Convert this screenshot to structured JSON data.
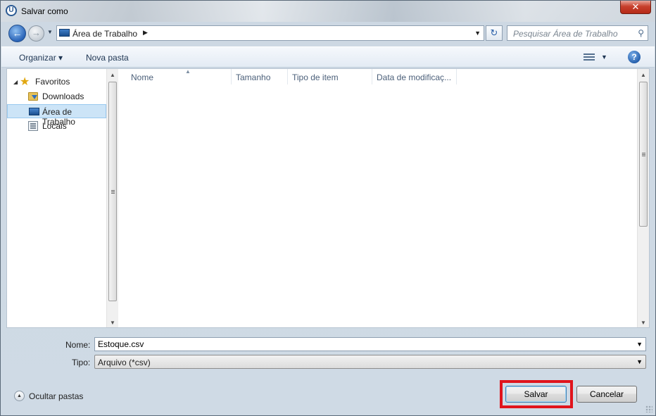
{
  "window": {
    "title": "Salvar como",
    "close_symbol": "✕"
  },
  "address_bar": {
    "location_icon": "desktop-icon",
    "breadcrumb": "Área de Trabalho",
    "search_placeholder": "Pesquisar Área de Trabalho"
  },
  "toolbar": {
    "organize_label": "Organizar",
    "new_folder_label": "Nova pasta"
  },
  "nav_pane": {
    "items": [
      {
        "label": "Favoritos",
        "icon": "star-icon",
        "selected": false
      },
      {
        "label": "Downloads",
        "icon": "downloads-folder-icon",
        "selected": false
      },
      {
        "label": "Área de Trabalho",
        "icon": "desktop-icon",
        "selected": true
      },
      {
        "label": "Locais",
        "icon": "recent-places-icon",
        "selected": false
      }
    ]
  },
  "file_list": {
    "columns": [
      "Nome",
      "Tamanho",
      "Tipo de item",
      "Data de modificaç..."
    ],
    "rows": []
  },
  "form": {
    "name_label": "Nome:",
    "name_value": "Estoque.csv",
    "type_label": "Tipo:",
    "type_value": "Arquivo (*csv)"
  },
  "footer": {
    "hide_folders_label": "Ocultar pastas",
    "save_label": "Salvar",
    "cancel_label": "Cancelar"
  },
  "colors": {
    "highlight_box": "#e0141c",
    "selection": "#cce4f7",
    "close_button": "#c7402d"
  }
}
